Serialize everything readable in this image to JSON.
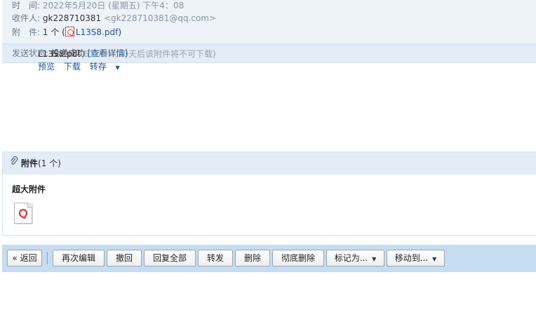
{
  "header": {
    "time_label": "时　间:",
    "time_value": "2022年5月20日 (星期五) 下午4：08",
    "recipient_label": "收件人:",
    "recipient_name": "gk228710381",
    "recipient_email": "<gk228710381@qq.com>",
    "attachment_label": "附　件:",
    "attachment_count": "1 个 (",
    "attachment_file": "L13S8.pdf",
    "attachment_close": ")"
  },
  "status": {
    "label": "发送状态:",
    "value": "投递成功",
    "details_link": "[查看详情]"
  },
  "attachments_panel": {
    "title": "附件",
    "count": "(1 个)",
    "section_title": "超大附件",
    "file": {
      "name": "L13S8.pdf",
      "note": "(61.79M,30天后该附件将不可下载)",
      "actions": {
        "preview": "预览",
        "download": "下载",
        "save": "转存"
      }
    }
  },
  "toolbar": {
    "back": "« 返回",
    "edit_again": "再次编辑",
    "recall": "撤回",
    "reply_all": "回复全部",
    "forward": "转发",
    "delete": "删除",
    "delete_permanently": "彻底删除",
    "mark_as": "标记为...",
    "move_to": "移动到..."
  }
}
